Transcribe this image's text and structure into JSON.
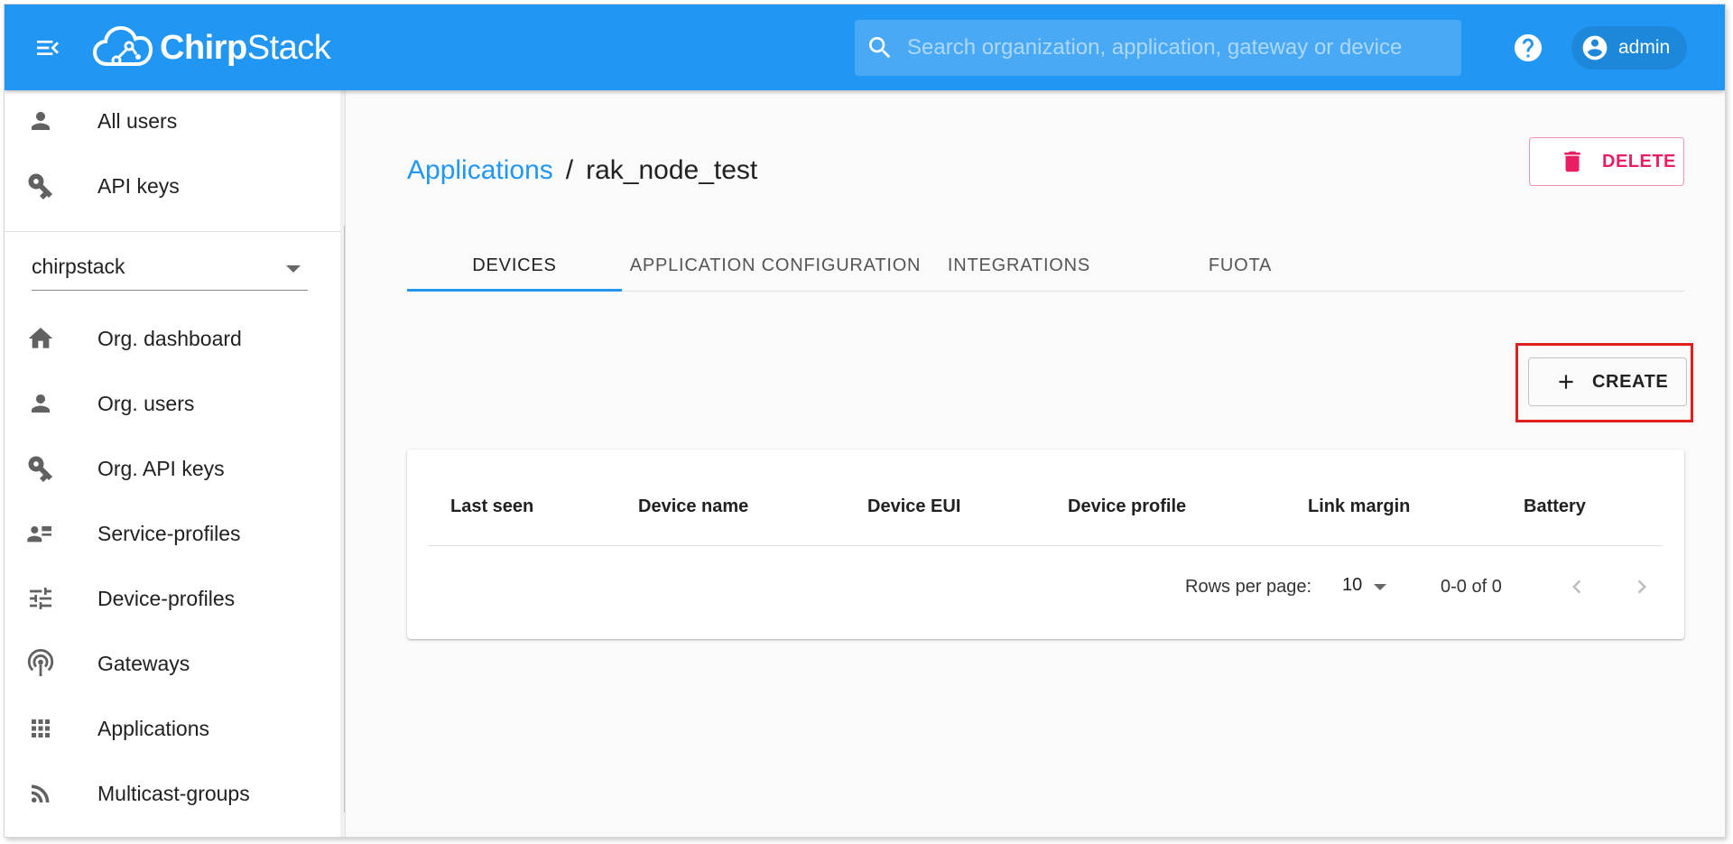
{
  "app": {
    "logo_text_bold": "Chirp",
    "logo_text_rest": "Stack",
    "brand_color": "#2196f3"
  },
  "header": {
    "search_placeholder": "Search organization, application, gateway or device",
    "user_label": "admin"
  },
  "sidebar": {
    "top_items": [
      {
        "label": "All users",
        "icon": "person-icon"
      },
      {
        "label": "API keys",
        "icon": "key-icon"
      }
    ],
    "organization_selected": "chirpstack",
    "org_items": [
      {
        "label": "Org. dashboard",
        "icon": "home-icon"
      },
      {
        "label": "Org. users",
        "icon": "person-icon"
      },
      {
        "label": "Org. API keys",
        "icon": "key-icon"
      },
      {
        "label": "Service-profiles",
        "icon": "contact-list-icon"
      },
      {
        "label": "Device-profiles",
        "icon": "sliders-icon"
      },
      {
        "label": "Gateways",
        "icon": "antenna-icon"
      },
      {
        "label": "Applications",
        "icon": "grid-icon"
      },
      {
        "label": "Multicast-groups",
        "icon": "rss-icon"
      }
    ]
  },
  "main": {
    "breadcrumb": {
      "parent": "Applications",
      "separator": "/",
      "current": "rak_node_test"
    },
    "delete_label": "DELETE",
    "tabs": [
      {
        "label": "DEVICES",
        "active": true
      },
      {
        "label": "APPLICATION CONFIGURATION",
        "active": false
      },
      {
        "label": "INTEGRATIONS",
        "active": false
      },
      {
        "label": "FUOTA",
        "active": false
      }
    ],
    "create_label": "CREATE",
    "table": {
      "columns": [
        "Last seen",
        "Device name",
        "Device EUI",
        "Device profile",
        "Link margin",
        "Battery"
      ],
      "rows": [],
      "rows_per_page_label": "Rows per page:",
      "rows_per_page": "10",
      "range_label": "0-0 of 0"
    },
    "highlight_color": "#e02020",
    "delete_color": "#e91e63"
  }
}
